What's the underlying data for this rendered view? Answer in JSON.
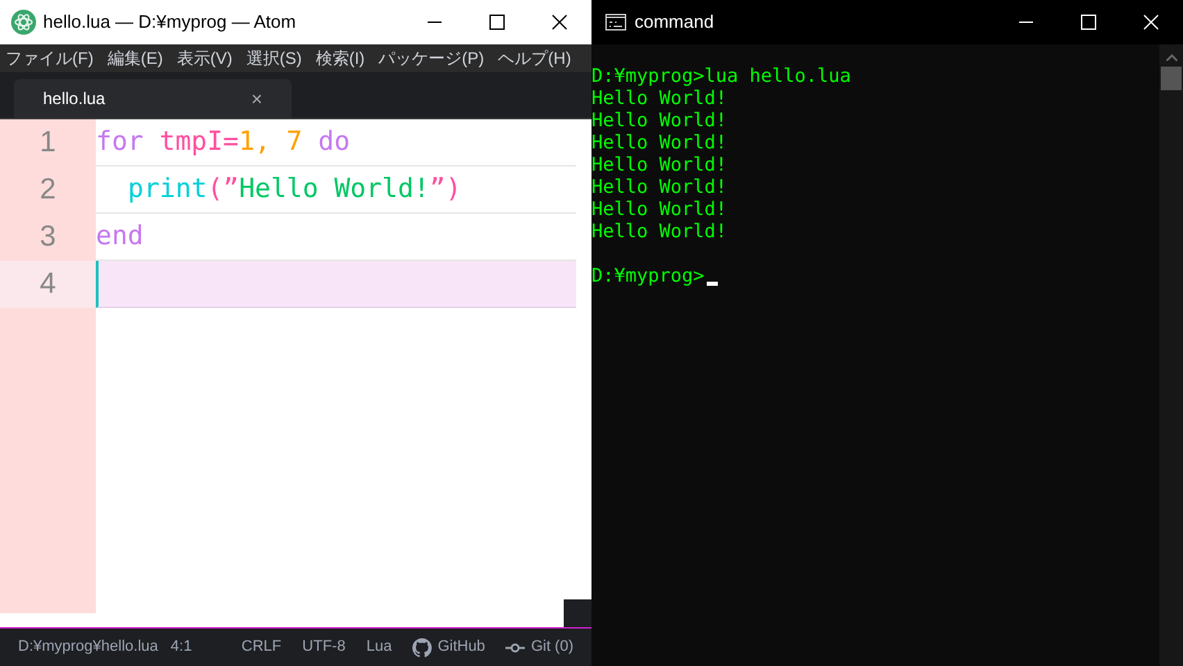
{
  "editor_window": {
    "title": "hello.lua — D:¥myprog — Atom",
    "menu": [
      "ファイル(F)",
      "編集(E)",
      "表示(V)",
      "選択(S)",
      "検索(I)",
      "パッケージ(P)",
      "ヘルプ(H)"
    ],
    "tabs": [
      {
        "label": "hello.lua",
        "selected": true,
        "close": "×"
      }
    ],
    "lines": [
      {
        "number": "1",
        "current": false,
        "indented": false,
        "tokens": [
          {
            "kind": "keyword",
            "text": "for "
          },
          {
            "kind": "variable",
            "text": "tmpI="
          },
          {
            "kind": "number",
            "text": "1, 7 "
          },
          {
            "kind": "keyword",
            "text": "do"
          }
        ]
      },
      {
        "number": "2",
        "current": false,
        "indented": true,
        "tokens": [
          {
            "kind": "function",
            "text": "print"
          },
          {
            "kind": "variable",
            "text": "(”"
          },
          {
            "kind": "string",
            "text": "Hello World!"
          },
          {
            "kind": "variable",
            "text": "”)"
          }
        ]
      },
      {
        "number": "3",
        "current": false,
        "indented": false,
        "tokens": [
          {
            "kind": "keyword",
            "text": "end"
          }
        ]
      },
      {
        "number": "4",
        "current": true,
        "indented": false
      }
    ],
    "status_bar": {
      "path": "D:¥myprog¥hello.lua",
      "cursor": "4:1",
      "line_ending": "CRLF",
      "encoding": "UTF-8",
      "grammar": "Lua",
      "github": "GitHub",
      "git": "Git (0)"
    }
  },
  "terminal_window": {
    "title": "command",
    "output": [
      "D:¥myprog>lua hello.lua",
      "Hello World!",
      "Hello World!",
      "Hello World!",
      "Hello World!",
      "Hello World!",
      "Hello World!",
      "Hello World!"
    ],
    "prompt": "D:¥myprog>"
  }
}
